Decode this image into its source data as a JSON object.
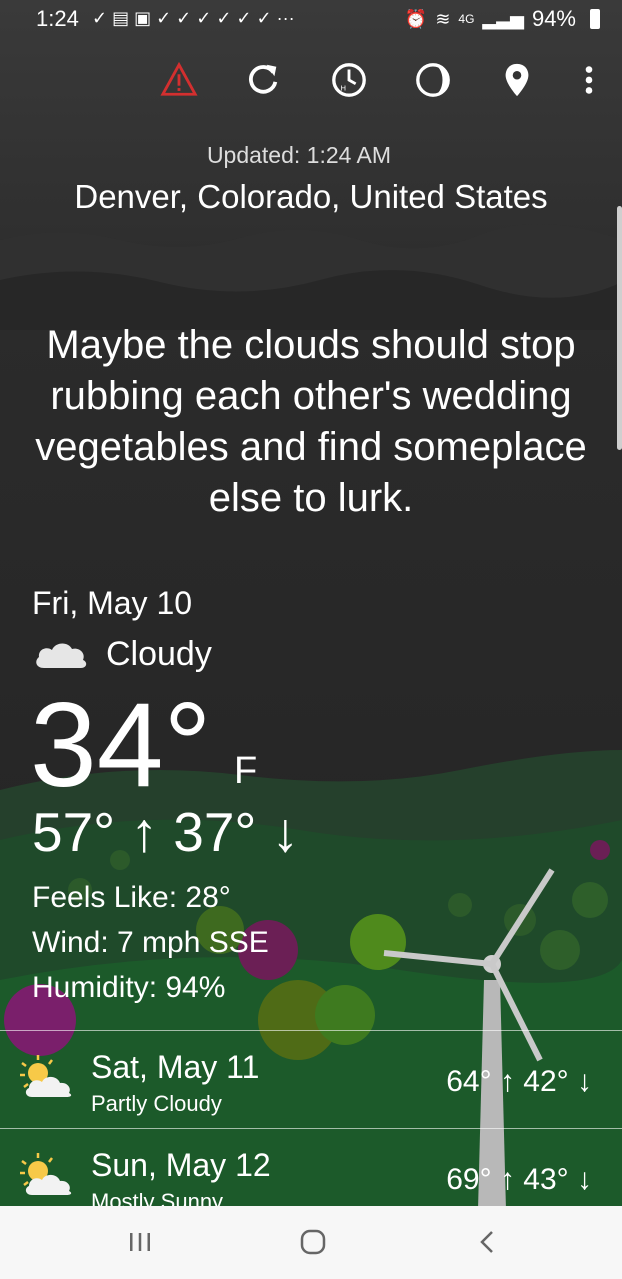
{
  "status_bar": {
    "time": "1:24",
    "battery": "94%",
    "network": "4G"
  },
  "toolbar": {
    "items": [
      {
        "name": "alert",
        "icon": "warning-triangle-icon",
        "color": "#d32f2f"
      },
      {
        "name": "refresh",
        "icon": "refresh-icon"
      },
      {
        "name": "hourly",
        "icon": "clock-hourly-icon"
      },
      {
        "name": "moon",
        "icon": "moon-phase-icon"
      },
      {
        "name": "location",
        "icon": "location-pin-icon"
      },
      {
        "name": "menu",
        "icon": "more-vert-icon"
      }
    ]
  },
  "header": {
    "updated": "Updated: 1:24 AM",
    "location": "Denver, Colorado, United States"
  },
  "quip": "Maybe the clouds should stop rubbing each other's wedding vegetables and find someplace else to lurk.",
  "today": {
    "date": "Fri, May 10",
    "condition": "Cloudy",
    "condition_icon": "cloud-icon",
    "temp": "34°",
    "unit": "F",
    "hilo": "57° ↑ 37° ↓",
    "feels_like": "Feels Like: 28°",
    "wind": "Wind: 7 mph SSE",
    "humidity": "Humidity: 94%"
  },
  "forecast": [
    {
      "day": "Sat, May 11",
      "condition": "Partly Cloudy",
      "icon": "partly-cloudy-icon",
      "hilo": "64° ↑ 42° ↓"
    },
    {
      "day": "Sun, May 12",
      "condition": "Mostly Sunny",
      "icon": "partly-cloudy-icon",
      "hilo": "69° ↑ 43° ↓"
    }
  ],
  "colors": {
    "sky": "#262626",
    "hills": "#1f4a2a",
    "alert": "#d32f2f"
  }
}
